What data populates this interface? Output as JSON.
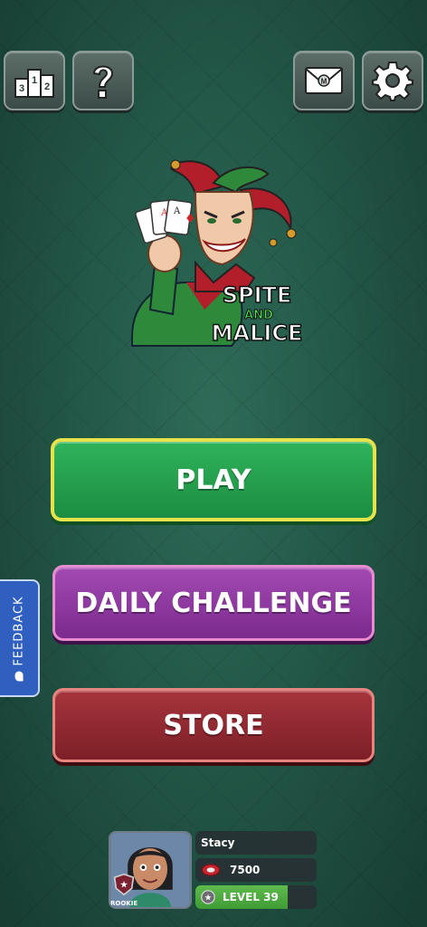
{
  "top_bar": {
    "leaderboard_icon": "podium-icon",
    "leaderboard_labels": [
      "1",
      "2",
      "3"
    ],
    "help_icon": "question-mark-icon",
    "mail_icon": "envelope-icon",
    "mail_badge": "M",
    "settings_icon": "gear-icon"
  },
  "logo": {
    "line1": "SPITE",
    "line2": "AND",
    "line3": "MALICE",
    "icon": "jester-holding-cards"
  },
  "menu": {
    "play_label": "PLAY",
    "daily_label": "DAILY CHALLENGE",
    "store_label": "STORE"
  },
  "feedback": {
    "label": "FEEDBACK",
    "icon": "chat-bubble-icon"
  },
  "profile": {
    "name": "Stacy",
    "coins": "7500",
    "level_label": "LEVEL 39",
    "rank": "ROOKIE",
    "level_progress": 0.76
  },
  "colors": {
    "play": "#25a04e",
    "play_border": "#e6e34a",
    "daily": "#8f3aa1",
    "store": "#931f2a",
    "feedback": "#2f5fbf"
  }
}
